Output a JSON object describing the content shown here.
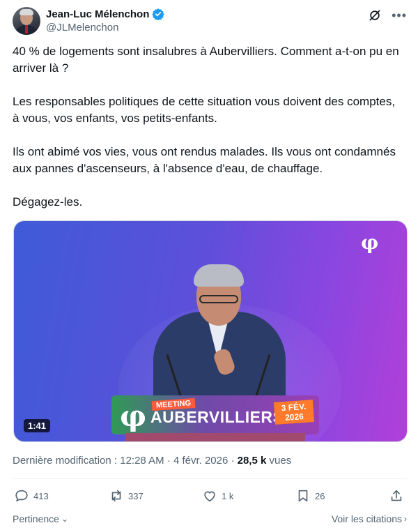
{
  "author": {
    "display_name": "Jean-Luc Mélenchon",
    "handle": "@JLMelenchon",
    "verified_icon": "verified-badge-icon"
  },
  "tweet": {
    "paragraphs": [
      "40 % de logements sont insalubres à Aubervilliers. Comment a-t-on pu en arriver là ?",
      "Les responsables politiques de cette situation vous doivent des comptes, à vous, vos enfants, vos petits-enfants.",
      "Ils ont abimé vos vies, vous ont rendus malades. Ils vous ont condamnés aux pannes d'ascenseurs, à l'absence d'eau, de chauffage.",
      "Dégagez-les."
    ]
  },
  "media": {
    "duration": "1:41",
    "podium_tag": "MEETING",
    "podium_city": "AUBERVILLIERS",
    "podium_date_line1": "3 FÉV.",
    "podium_date_line2": "2026",
    "logo_text": "LA FRANCE INSOUMISE"
  },
  "meta": {
    "prefix": "Dernière modification : 12:28 AM · 4 févr. 2026 · ",
    "views_count": "28,5 k",
    "views_label": " vues"
  },
  "actions": {
    "replies": "413",
    "reposts": "337",
    "likes": "1 k",
    "bookmarks": "26"
  },
  "footer": {
    "sort_label": "Pertinence",
    "quotes_label": "Voir les citations"
  },
  "colors": {
    "text_primary": "#0f1419",
    "text_secondary": "#536471",
    "verified_blue": "#1d9bf0"
  }
}
